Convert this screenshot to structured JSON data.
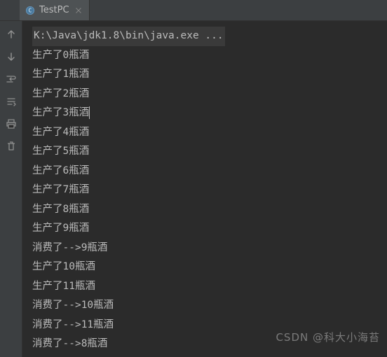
{
  "tab": {
    "title": "TestPC",
    "icon": "class-icon"
  },
  "command_line": "K:\\Java\\jdk1.8\\bin\\java.exe ...",
  "caret_line_index": 4,
  "console_lines": [
    "生产了0瓶酒",
    "生产了1瓶酒",
    "生产了2瓶酒",
    "生产了3瓶酒",
    "生产了4瓶酒",
    "生产了5瓶酒",
    "生产了6瓶酒",
    "生产了7瓶酒",
    "生产了8瓶酒",
    "生产了9瓶酒",
    "消费了-->9瓶酒",
    "生产了10瓶酒",
    "生产了11瓶酒",
    "消费了-->10瓶酒",
    "消费了-->11瓶酒",
    "消费了-->8瓶酒"
  ],
  "gutter": [
    {
      "name": "arrow-up-icon"
    },
    {
      "name": "arrow-down-icon"
    },
    {
      "name": "soft-wrap-icon"
    },
    {
      "name": "scroll-to-end-icon"
    },
    {
      "name": "print-icon"
    },
    {
      "name": "trash-icon"
    }
  ],
  "watermark": {
    "main": "CSDN @科大小海苔",
    "sub": ""
  }
}
